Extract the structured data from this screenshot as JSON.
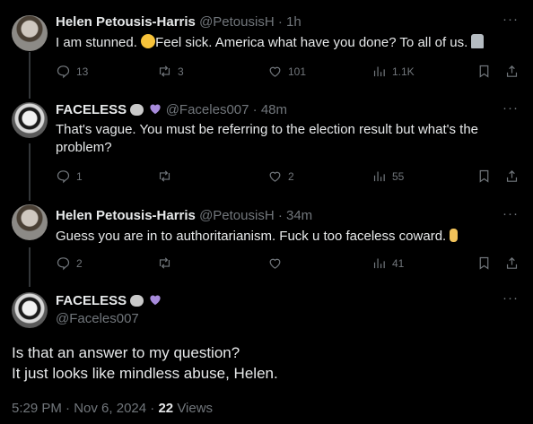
{
  "tweets": [
    {
      "name": "Helen Petousis-Harris",
      "handle": "@PetousisH",
      "time": "1h",
      "text_a": "I am stunned.",
      "text_b": "Feel sick. America what have you done?  To all of us.",
      "replies": "13",
      "reposts": "3",
      "likes": "101",
      "views": "1.1K"
    },
    {
      "name": "FACELESS",
      "handle": "@Faceles007",
      "time": "48m",
      "text": "That's vague. You must be referring to the election result but what's the problem?",
      "replies": "1",
      "reposts": "",
      "likes": "2",
      "views": "55"
    },
    {
      "name": "Helen Petousis-Harris",
      "handle": "@PetousisH",
      "time": "34m",
      "text": "Guess you are in to authoritarianism.  Fuck u too faceless coward.",
      "replies": "2",
      "reposts": "",
      "likes": "",
      "views": "41"
    }
  ],
  "main": {
    "name": "FACELESS",
    "handle": "@Faceles007",
    "line1": "Is that an answer to my question?",
    "line2": "It just looks like mindless abuse, Helen.",
    "time": "5:29 PM",
    "date": "Nov 6, 2024",
    "views_count": "22",
    "views_label": "Views"
  },
  "sep": "·",
  "more": "···",
  "colors": {
    "bg": "#000000",
    "text": "#e7e9ea",
    "muted": "#71767b",
    "heart_purple": "#a78bdb"
  },
  "icons": [
    "reply-icon",
    "repost-icon",
    "like-icon",
    "views-icon",
    "bookmark-icon",
    "share-icon",
    "more-icon"
  ]
}
